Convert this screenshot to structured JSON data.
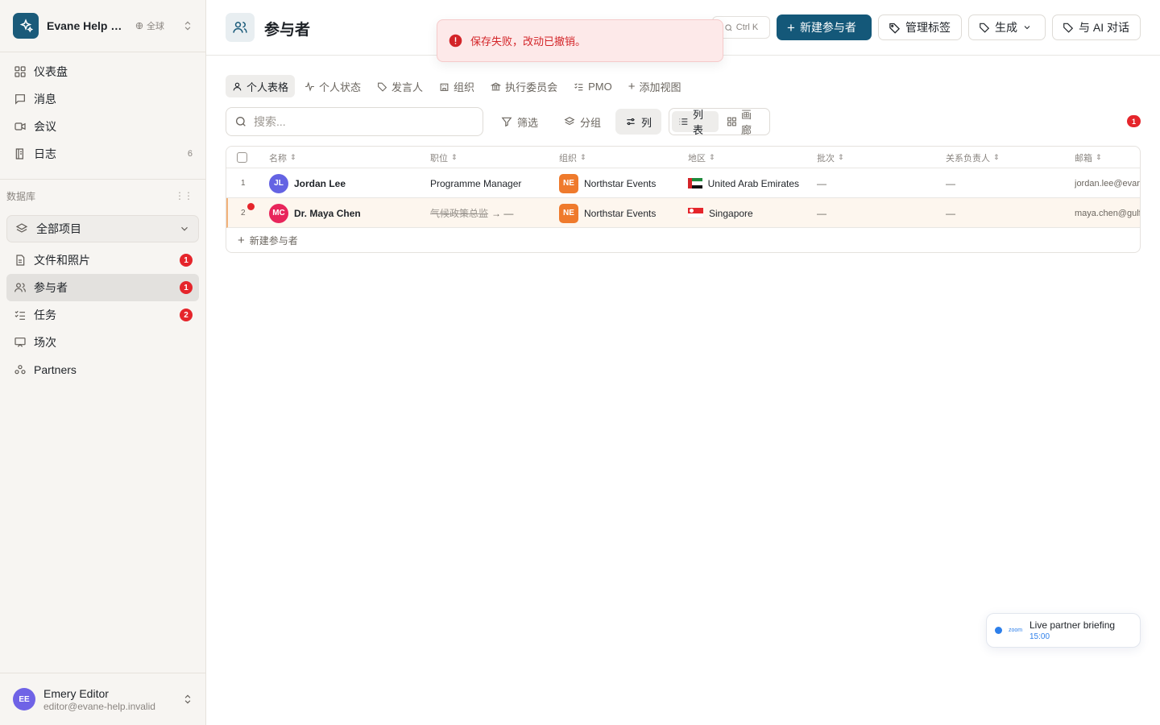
{
  "workspace": {
    "name": "Evane Help Center",
    "scope": "全球"
  },
  "sidebar": {
    "nav": [
      {
        "label": "仪表盘",
        "icon": "dashboard-icon",
        "count": ""
      },
      {
        "label": "消息",
        "icon": "message-icon",
        "count": ""
      },
      {
        "label": "会议",
        "icon": "video-icon",
        "count": ""
      },
      {
        "label": "日志",
        "icon": "log-icon",
        "count": "6"
      }
    ],
    "db_label": "数据库",
    "db_select": "全部项目",
    "db_items": [
      {
        "label": "文件和照片",
        "icon": "file-icon",
        "badge": "1"
      },
      {
        "label": "参与者",
        "icon": "people-icon",
        "badge": "1"
      },
      {
        "label": "任务",
        "icon": "checklist-icon",
        "badge": "2"
      },
      {
        "label": "场次",
        "icon": "session-icon",
        "badge": ""
      },
      {
        "label": "Partners",
        "icon": "partners-icon",
        "badge": ""
      }
    ],
    "user": {
      "initials": "EE",
      "name": "Emery Editor",
      "email": "editor@evane-help.invalid"
    }
  },
  "header": {
    "title": "参与者",
    "shortcut": "Ctrl K",
    "new_button": "新建参与者",
    "manage_tags": "管理标签",
    "generate": "生成",
    "ai_chat": "与 AI 对话"
  },
  "toast": {
    "message": "保存失败，改动已撤销。"
  },
  "tabs": [
    {
      "label": "个人表格",
      "icon": "person-icon"
    },
    {
      "label": "个人状态",
      "icon": "activity-icon"
    },
    {
      "label": "发言人",
      "icon": "tag-icon"
    },
    {
      "label": "组织",
      "icon": "building-icon"
    },
    {
      "label": "执行委员会",
      "icon": "bank-icon"
    },
    {
      "label": "PMO",
      "icon": "checklist-icon"
    },
    {
      "label": "添加视图",
      "icon": "plus-icon"
    }
  ],
  "toolbar": {
    "search_placeholder": "搜索...",
    "filter": "筛选",
    "group": "分组",
    "columns": "列",
    "view_list": "列表",
    "view_gallery": "画廊",
    "alert_count": "1"
  },
  "table": {
    "headers": [
      "名称",
      "职位",
      "组织",
      "地区",
      "批次",
      "关系负责人",
      "邮箱"
    ],
    "rows": [
      {
        "num": "1",
        "initials": "JL",
        "avatar_color": "#6463e3",
        "name": "Jordan Lee",
        "title": "Programme Manager",
        "org_initials": "NE",
        "org": "Northstar Events",
        "region": "United Arab Emirates",
        "batch": "—",
        "owner": "—",
        "email": "jordan.lee@evane-help.invalid"
      },
      {
        "num": "2",
        "initials": "MC",
        "avatar_color": "#e8255b",
        "name": "Dr. Maya Chen",
        "title_old": "气候政策总监",
        "title_new": "→ —",
        "org_initials": "NE",
        "org": "Northstar Events",
        "region": "Singapore",
        "batch": "—",
        "owner": "—",
        "email": "maya.chen@gulf-climate.invalid"
      }
    ],
    "add_row": "新建参与者"
  },
  "live": {
    "provider": "zoom",
    "title": "Live partner briefing",
    "time": "15:00"
  }
}
